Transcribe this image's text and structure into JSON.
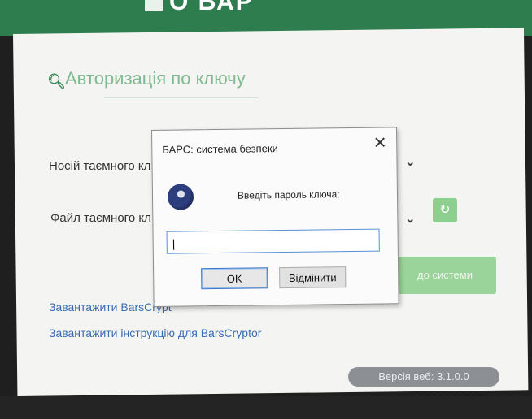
{
  "window": {
    "title_fragment": "О БАР"
  },
  "auth": {
    "title": "Авторизація по ключу",
    "key_carrier_label": "Носій таємного кл",
    "key_file_label": "Файл таємного кл",
    "enter_button": "до системи",
    "download_link": "Завантажити BarsCrypt",
    "instruction_link": "Завантажити інструкцію для BarsCryptor",
    "version": "Версія веб: 3.1.0.0"
  },
  "dialog": {
    "title": "БАРС: система безпеки",
    "close": "✕",
    "prompt": "Введіть пароль ключа:",
    "input_value": "|",
    "ok_label": "OK",
    "cancel_label": "Відмінити"
  },
  "icons": {
    "auth": "key-search-icon",
    "refresh": "refresh-icon",
    "chevron": "chevron-down-icon",
    "key": "key-icon"
  },
  "colors": {
    "brand_green": "#2e7d4f",
    "accent_green": "#8ccf8e",
    "link_blue": "#3b6cb4"
  }
}
